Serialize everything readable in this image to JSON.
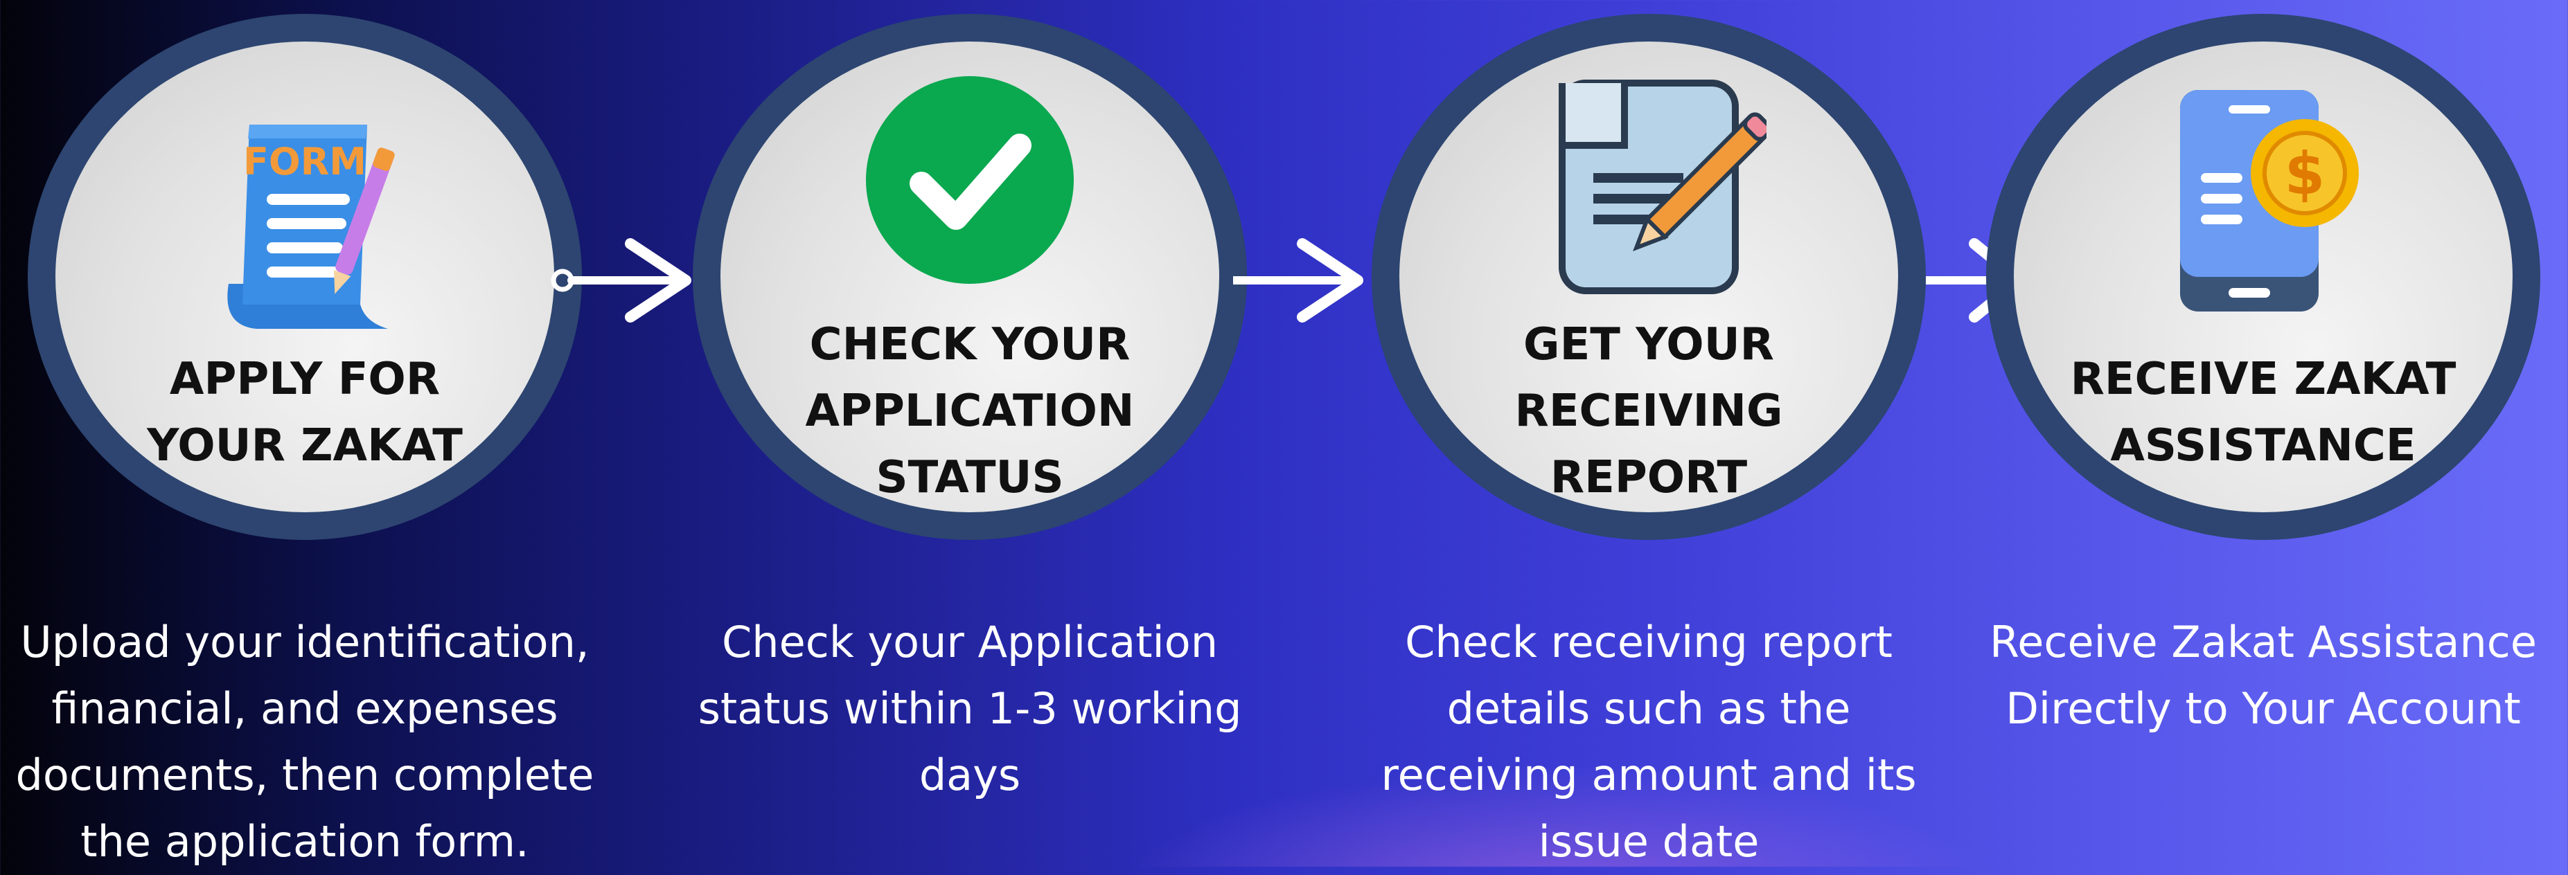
{
  "steps": [
    {
      "title_lines": [
        "APPLY FOR",
        "YOUR ZAKAT"
      ],
      "desc_lines": [
        "Upload your identification,",
        "financial, and expenses",
        "documents, then complete",
        "the application form."
      ],
      "icon": "form-icon",
      "icon_text": "FORM"
    },
    {
      "title_lines": [
        "CHECK YOUR",
        "APPLICATION",
        "STATUS"
      ],
      "desc_lines": [
        "Check your Application",
        "status within 1-3 working",
        "days"
      ],
      "icon": "checkmark-icon"
    },
    {
      "title_lines": [
        "GET YOUR",
        "RECEIVING",
        "REPORT"
      ],
      "desc_lines": [
        "Check receiving report",
        "details such as the",
        "receiving amount and its",
        "issue date"
      ],
      "icon": "document-pencil-icon"
    },
    {
      "title_lines": [
        "RECEIVE ZAKAT",
        "ASSISTANCE"
      ],
      "desc_lines": [
        "Receive Zakat Assistance",
        "Directly to Your Account"
      ],
      "icon": "phone-dollar-icon",
      "icon_text": "$"
    }
  ],
  "colors": {
    "ring": "#2d4570",
    "check_green": "#0aa84f",
    "form_blue": "#3a8ee6",
    "form_orange": "#f29a3a",
    "coin_yellow": "#f5b700",
    "phone_blue": "#6b9bf2"
  }
}
